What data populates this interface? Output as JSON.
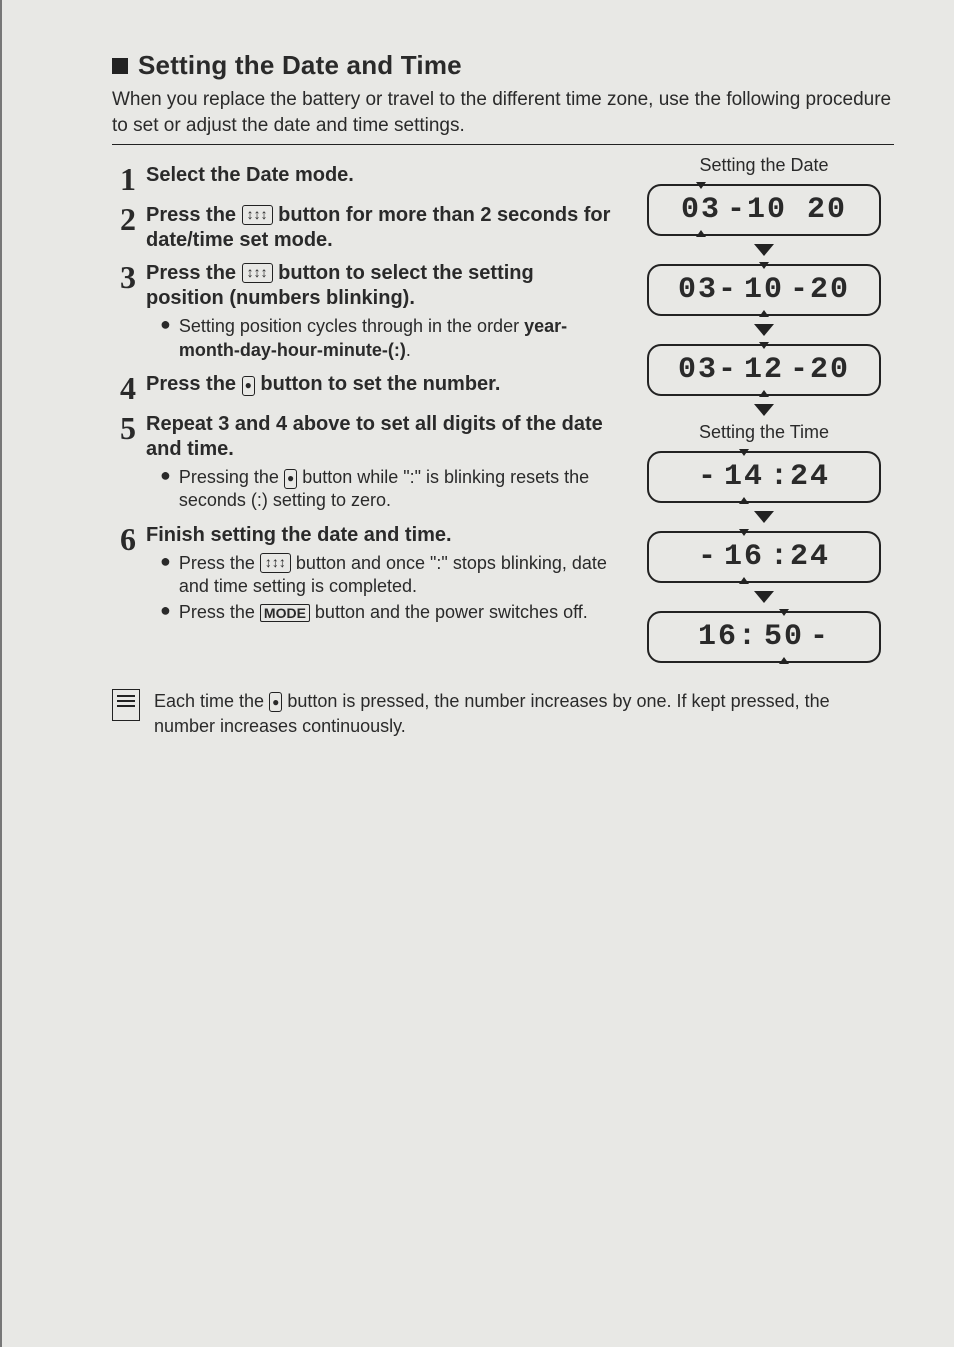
{
  "header": {
    "title": "Setting the Date and Time",
    "intro": "When you replace the battery or travel to the different time zone, use the following procedure to set or adjust the date and time settings."
  },
  "buttons": {
    "select": "↕↕↕",
    "set": "●",
    "mode": "MODE"
  },
  "steps": [
    {
      "num": "1",
      "title": "Select the Date mode."
    },
    {
      "num": "2",
      "title_a": "Press the ",
      "title_b": " button for more than 2 seconds for date/time set mode."
    },
    {
      "num": "3",
      "title_a": "Press the ",
      "title_b": " button to select the setting position (numbers blinking).",
      "sub": [
        {
          "a": "Setting position cycles through in the order ",
          "b": "year-month-day-hour-minute-(:)",
          "c": "."
        }
      ]
    },
    {
      "num": "4",
      "title_a": "Press the ",
      "title_b": " button to set the number."
    },
    {
      "num": "5",
      "title": "Repeat 3 and 4 above to set all digits of the date and time.",
      "sub": [
        {
          "a": "Pressing the ",
          "b": " button while \":\" is blinking resets the seconds (:) setting to zero."
        }
      ]
    },
    {
      "num": "6",
      "title": "Finish setting the date and time.",
      "sub": [
        {
          "a": "Press the ",
          "b": " button and once \":\" stops blinking, date and time setting is completed."
        },
        {
          "a": "Press the ",
          "b": " button and the power switches off."
        }
      ]
    }
  ],
  "right": {
    "title1": "Setting the Date",
    "title2": "Setting the Time",
    "lcd": {
      "d1_a": "03",
      "d1_b": "-10 20",
      "d2_a": "03-",
      "d2_b": "10",
      "d2_c": "-20",
      "d3_a": "03-",
      "d3_b": "12",
      "d3_c": "-20",
      "t1_a": "- ",
      "t1_b": "14",
      "t1_c": ":24",
      "t2_a": "- ",
      "t2_b": "16",
      "t2_c": ":24",
      "t3_a": "16:",
      "t3_b": "50",
      "t3_c": "-"
    }
  },
  "note": {
    "a": "Each time the ",
    "b": " button is pressed, the number increases by one. If kept pressed, the number increases continuously."
  }
}
